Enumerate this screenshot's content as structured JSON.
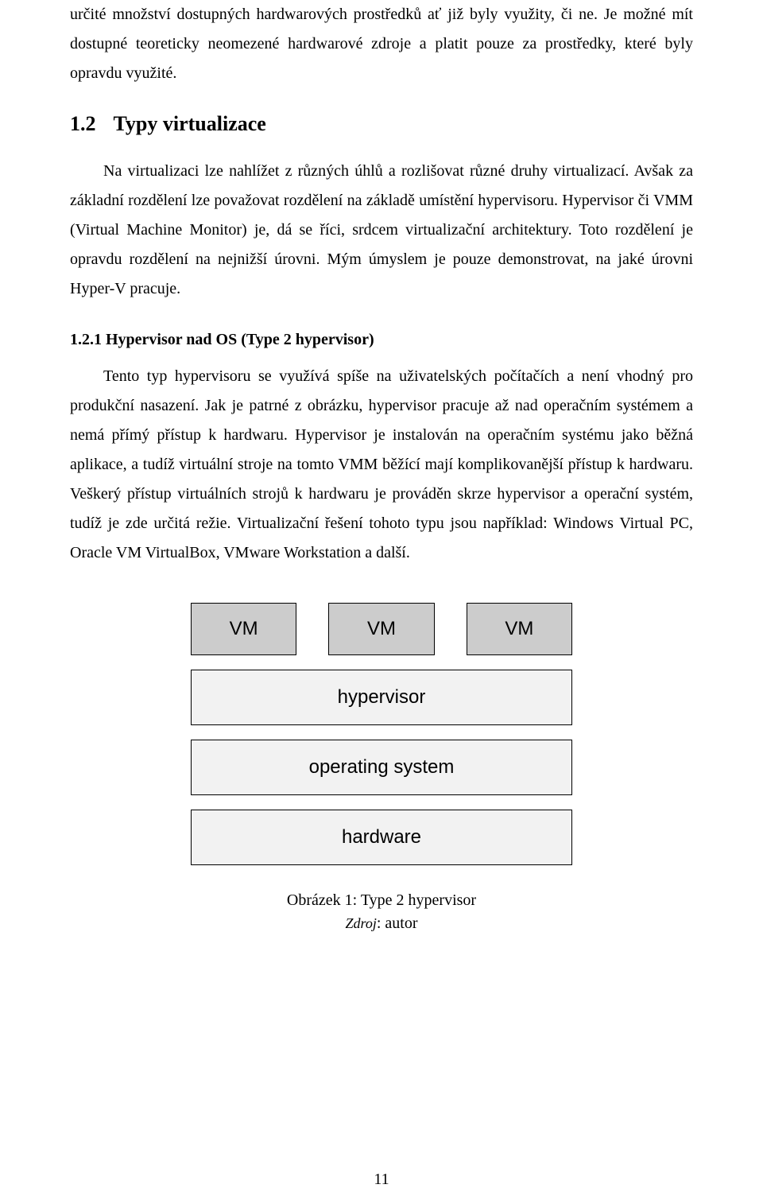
{
  "paragraphs": {
    "p1": "určité množství dostupných hardwarových prostředků ať již byly využity, či ne. Je možné mít dostupné teoreticky neomezené hardwarové zdroje a platit pouze za prostředky, které byly opravdu využité.",
    "sec12_body": "Na virtualizaci lze nahlížet z různých úhlů a rozlišovat různé druhy virtualizací. Avšak za základní rozdělení lze považovat rozdělení na základě umístění hypervisoru. Hypervisor či VMM (Virtual Machine Monitor) je, dá se říci, srdcem virtualizační architektury. Toto rozdělení je opravdu rozdělení na nejnižší úrovni. Mým úmyslem je pouze demonstrovat, na jaké úrovni Hyper-V pracuje.",
    "sec121_body": "Tento typ hypervisoru se využívá spíše na uživatelských počítačích a není vhodný pro produkční nasazení. Jak je patrné z obrázku, hypervisor pracuje až nad operačním systémem a nemá přímý přístup k hardwaru. Hypervisor je instalován na operačním systému jako běžná aplikace, a tudíž virtuální stroje na tomto VMM běžící mají komplikovanější přístup k hardwaru. Veškerý přístup virtuálních strojů k hardwaru je prováděn skrze hypervisor a operační systém, tudíž je zde určitá režie. Virtualizační řešení tohoto typu jsou například: Windows Virtual PC, Oracle VM VirtualBox, VMware Workstation a další."
  },
  "headings": {
    "sec12_num": "1.2",
    "sec12_title": "Typy virtualizace",
    "sec121": "1.2.1 Hypervisor nad OS (Type 2 hypervisor)"
  },
  "figure": {
    "vm": "VM",
    "hypervisor": "hypervisor",
    "os": "operating system",
    "hardware": "hardware",
    "caption": "Obrázek 1: Type 2 hypervisor",
    "source_label": "Zdroj",
    "source_value": ": autor"
  },
  "page_number": "11",
  "chart_data": {
    "type": "diagram",
    "description": "Layered architecture of a Type 2 hypervisor",
    "layers_top_to_bottom": [
      {
        "name": "VM",
        "count": 3,
        "fill": "#cccccc"
      },
      {
        "name": "hypervisor",
        "fill": "#f2f2f2"
      },
      {
        "name": "operating system",
        "fill": "#f2f2f2"
      },
      {
        "name": "hardware",
        "fill": "#f2f2f2"
      }
    ]
  }
}
